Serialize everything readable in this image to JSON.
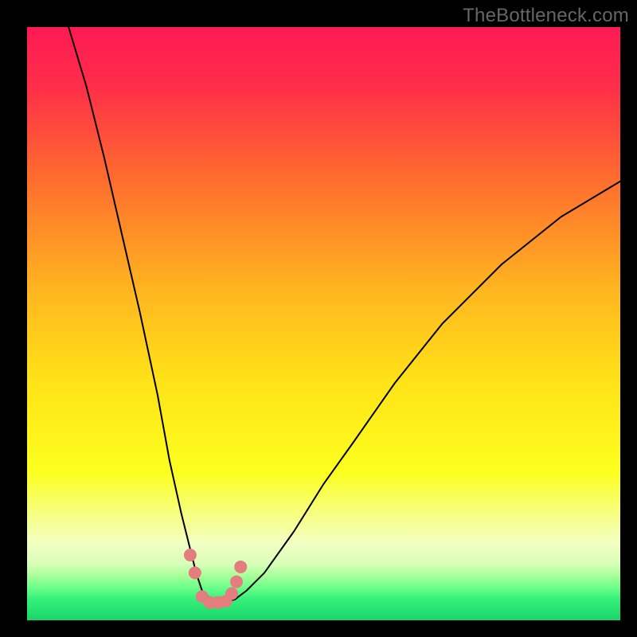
{
  "watermark": "TheBottleneck.com",
  "chart_data": {
    "type": "line",
    "title": "",
    "xlabel": "",
    "ylabel": "",
    "xlim": [
      0,
      100
    ],
    "ylim": [
      0,
      100
    ],
    "grid": false,
    "legend": false,
    "background": {
      "kind": "vertical-gradient",
      "stops": [
        {
          "pos": 0.0,
          "color": "#ff1a54"
        },
        {
          "pos": 0.1,
          "color": "#ff2e49"
        },
        {
          "pos": 0.25,
          "color": "#ff6a2f"
        },
        {
          "pos": 0.45,
          "color": "#ffb81f"
        },
        {
          "pos": 0.6,
          "color": "#ffe317"
        },
        {
          "pos": 0.75,
          "color": "#fcff1e"
        },
        {
          "pos": 0.83,
          "color": "#f6ff8e"
        },
        {
          "pos": 0.87,
          "color": "#f2ffc2"
        },
        {
          "pos": 0.905,
          "color": "#d8ffb8"
        },
        {
          "pos": 0.925,
          "color": "#a8ff9a"
        },
        {
          "pos": 0.945,
          "color": "#6cff88"
        },
        {
          "pos": 0.965,
          "color": "#34f07a"
        },
        {
          "pos": 1.0,
          "color": "#18d66a"
        }
      ]
    },
    "series": [
      {
        "name": "bottleneck-curve",
        "stroke": "#000000",
        "stroke_width": 2,
        "x": [
          7,
          10,
          13,
          16,
          19,
          22,
          24,
          26,
          27.5,
          28.5,
          29.5,
          31,
          33,
          35,
          37,
          40,
          45,
          50,
          55,
          62,
          70,
          80,
          90,
          100
        ],
        "y": [
          100,
          90,
          78,
          65,
          52,
          38,
          27,
          18,
          12,
          8,
          5,
          3.5,
          3,
          3.5,
          5,
          8,
          15,
          23,
          30,
          40,
          50,
          60,
          68,
          74
        ]
      },
      {
        "name": "optimal-markers",
        "type": "scatter",
        "marker_color": "#e47e7e",
        "marker_radius_px": 8,
        "x": [
          27.5,
          28.3,
          29.5,
          30.8,
          32.2,
          33.5,
          34.5,
          35.3,
          36.0
        ],
        "y": [
          11,
          8,
          4,
          3,
          3,
          3.2,
          4.5,
          6.5,
          9
        ]
      }
    ],
    "annotations": []
  }
}
